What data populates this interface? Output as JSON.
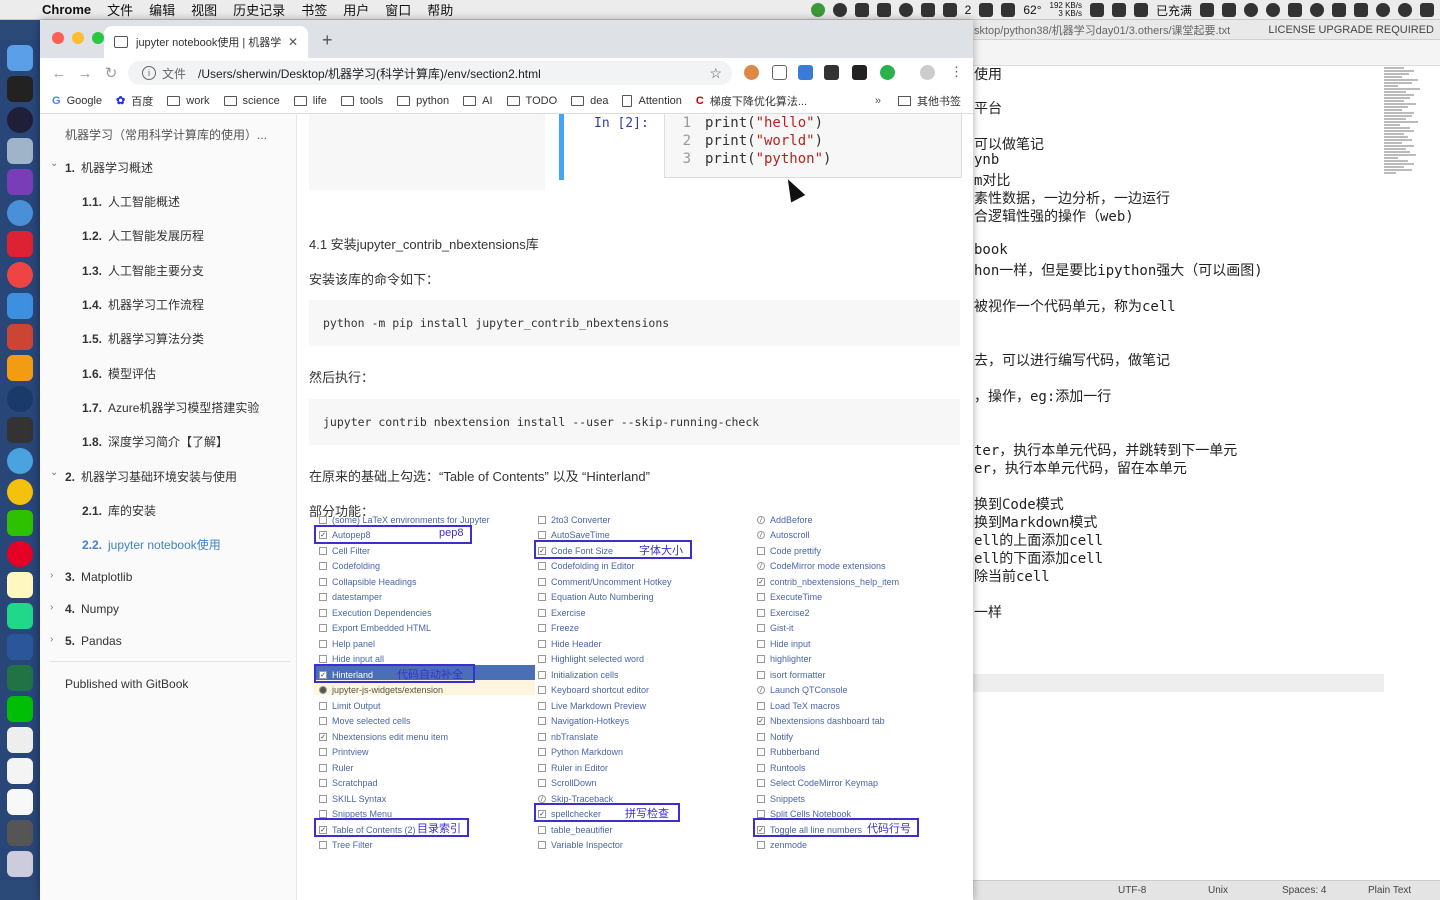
{
  "menubar": {
    "app": "Chrome",
    "items": [
      "文件",
      "编辑",
      "视图",
      "历史记录",
      "书签",
      "用户",
      "窗口",
      "帮助"
    ],
    "temperature": "62°",
    "net_up": "192 KB/s",
    "net_down": "3 KB/s",
    "battery": "已充满",
    "badge_count": "2"
  },
  "editor": {
    "title": "sktop/python38/机器学习day01/3.others/课堂起要.txt",
    "license": "LICENSE UPGRADE REQUIRED",
    "lines": [
      "使用",
      "平台",
      "可以做笔记",
      "ynb",
      "m对比",
      "素性数据，一边分析，一边运行",
      "合逻辑性强的操作（web)",
      "book",
      "hon一样，但是要比ipython强大（可以画图)",
      "被视作一个代码单元，称为cell",
      "去，可以进行编写代码，做笔记",
      "，操作，eg:添加一行",
      "ter，执行本单元代码，并跳转到下一单元",
      "er，执行本单元代码，留在本单元",
      "换到Code模式",
      "换到Markdown模式",
      "ell的上面添加cell",
      "ell的下面添加cell",
      "除当前cell",
      "一样"
    ],
    "status": {
      "encoding": "UTF-8",
      "line_endings": "Unix",
      "indent": "Spaces: 4",
      "syntax": "Plain Text"
    }
  },
  "browser": {
    "tab_title": "jupyter notebook使用 | 机器学",
    "url_scheme": "文件",
    "url": "/Users/sherwin/Desktop/机器学习(科学计算库)/env/section2.html",
    "bookmarks": [
      "Google",
      "百度",
      "work",
      "science",
      "life",
      "tools",
      "python",
      "AI",
      "TODO",
      "dea",
      "Attention",
      "梯度下降优化算法..."
    ],
    "bookmarks_more": "»",
    "other_bookmarks": "其他书签"
  },
  "sidebar": {
    "title": "机器学习（常用科学计算库的使用）...",
    "items": [
      {
        "num": "1.",
        "label": "机器学习概述"
      },
      {
        "num": "1.1.",
        "label": "人工智能概述"
      },
      {
        "num": "1.2.",
        "label": "人工智能发展历程"
      },
      {
        "num": "1.3.",
        "label": "人工智能主要分支"
      },
      {
        "num": "1.4.",
        "label": "机器学习工作流程"
      },
      {
        "num": "1.5.",
        "label": "机器学习算法分类"
      },
      {
        "num": "1.6.",
        "label": "模型评估"
      },
      {
        "num": "1.7.",
        "label": "Azure机器学习模型搭建实验"
      },
      {
        "num": "1.8.",
        "label": "深度学习简介【了解】"
      },
      {
        "num": "2.",
        "label": "机器学习基础环境安装与使用"
      },
      {
        "num": "2.1.",
        "label": "库的安装"
      },
      {
        "num": "2.2.",
        "label": "jupyter notebook使用"
      },
      {
        "num": "3.",
        "label": "Matplotlib"
      },
      {
        "num": "4.",
        "label": "Numpy"
      },
      {
        "num": "5.",
        "label": "Pandas"
      }
    ],
    "footer": "Published with GitBook"
  },
  "content": {
    "cell_prompt": "In [2]:",
    "cell_lines": [
      {
        "n": "1",
        "fn": "print(",
        "str": "\"hello\"",
        "end": ")"
      },
      {
        "n": "2",
        "fn": "print(",
        "str": "\"world\"",
        "end": ")"
      },
      {
        "n": "3",
        "fn": "print(",
        "str": "\"python\"",
        "end": ")"
      }
    ],
    "section_heading": "4.1 安装jupyter_contrib_nbextensions库",
    "install_intro": "安装该库的命令如下：",
    "install_cmd": "python -m pip install jupyter_contrib_nbextensions",
    "then_run": "然后执行：",
    "run_cmd": "jupyter contrib nbextension install --user --skip-running-check",
    "check_text": "在原来的基础上勾选：“Table of Contents” 以及 “Hinterland”",
    "features": "部分功能："
  },
  "extensions": {
    "col1": [
      {
        "label": "(some) LaTeX environments for Jupyter",
        "state": "none"
      },
      {
        "label": "Autopep8",
        "state": "on"
      },
      {
        "label": "Cell Filter",
        "state": "none"
      },
      {
        "label": "Codefolding",
        "state": "none"
      },
      {
        "label": "Collapsible Headings",
        "state": "none"
      },
      {
        "label": "datestamper",
        "state": "none"
      },
      {
        "label": "Execution Dependencies",
        "state": "none"
      },
      {
        "label": "Export Embedded HTML",
        "state": "none"
      },
      {
        "label": "Help panel",
        "state": "none"
      },
      {
        "label": "Hide input all",
        "state": "none"
      },
      {
        "label": "Hinterland",
        "state": "on"
      },
      {
        "label": "jupyter-js-widgets/extension",
        "state": "warn"
      },
      {
        "label": "Limit Output",
        "state": "none"
      },
      {
        "label": "Move selected cells",
        "state": "none"
      },
      {
        "label": "Nbextensions edit menu item",
        "state": "on"
      },
      {
        "label": "Printview",
        "state": "none"
      },
      {
        "label": "Ruler",
        "state": "none"
      },
      {
        "label": "Scratchpad",
        "state": "none"
      },
      {
        "label": "SKILL Syntax",
        "state": "none"
      },
      {
        "label": "Snippets Menu",
        "state": "none"
      },
      {
        "label": "Table of Contents (2)",
        "state": "on"
      },
      {
        "label": "Tree Filter",
        "state": "none"
      }
    ],
    "col2": [
      {
        "label": "2to3 Converter",
        "state": "none"
      },
      {
        "label": "AutoSaveTime",
        "state": "none"
      },
      {
        "label": "Code Font Size",
        "state": "on"
      },
      {
        "label": "Codefolding in Editor",
        "state": "none"
      },
      {
        "label": "Comment/Uncomment Hotkey",
        "state": "none"
      },
      {
        "label": "Equation Auto Numbering",
        "state": "none"
      },
      {
        "label": "Exercise",
        "state": "none"
      },
      {
        "label": "Freeze",
        "state": "none"
      },
      {
        "label": "Hide Header",
        "state": "none"
      },
      {
        "label": "Highlight selected word",
        "state": "none"
      },
      {
        "label": "Initialization cells",
        "state": "none"
      },
      {
        "label": "Keyboard shortcut editor",
        "state": "none"
      },
      {
        "label": "Live Markdown Preview",
        "state": "none"
      },
      {
        "label": "Navigation-Hotkeys",
        "state": "none"
      },
      {
        "label": "nbTranslate",
        "state": "none"
      },
      {
        "label": "Python Markdown",
        "state": "none"
      },
      {
        "label": "Ruler in Editor",
        "state": "none"
      },
      {
        "label": "ScrollDown",
        "state": "none"
      },
      {
        "label": "Skip-Traceback",
        "state": "off"
      },
      {
        "label": "spellchecker",
        "state": "on"
      },
      {
        "label": "table_beautifier",
        "state": "none"
      },
      {
        "label": "Variable Inspector",
        "state": "none"
      }
    ],
    "col3": [
      {
        "label": "AddBefore",
        "state": "off"
      },
      {
        "label": "Autoscroll",
        "state": "off"
      },
      {
        "label": "Code prettify",
        "state": "none"
      },
      {
        "label": "CodeMirror mode extensions",
        "state": "off"
      },
      {
        "label": "contrib_nbextensions_help_item",
        "state": "on"
      },
      {
        "label": "ExecuteTime",
        "state": "none"
      },
      {
        "label": "Exercise2",
        "state": "none"
      },
      {
        "label": "Gist-it",
        "state": "none"
      },
      {
        "label": "Hide input",
        "state": "none"
      },
      {
        "label": "highlighter",
        "state": "none"
      },
      {
        "label": "isort formatter",
        "state": "none"
      },
      {
        "label": "Launch QTConsole",
        "state": "off"
      },
      {
        "label": "Load TeX macros",
        "state": "none"
      },
      {
        "label": "Nbextensions dashboard tab",
        "state": "on"
      },
      {
        "label": "Notify",
        "state": "none"
      },
      {
        "label": "Rubberband",
        "state": "none"
      },
      {
        "label": "Runtools",
        "state": "none"
      },
      {
        "label": "Select CodeMirror Keymap",
        "state": "none"
      },
      {
        "label": "Snippets",
        "state": "none"
      },
      {
        "label": "Split Cells Notebook",
        "state": "none"
      },
      {
        "label": "Toggle all line numbers",
        "state": "on"
      },
      {
        "label": "zenmode",
        "state": "none"
      }
    ],
    "annotations": {
      "pep8": "pep8",
      "font_size": "字体大小",
      "hinterland": "代码自动补全",
      "toc": "目录索引",
      "spell": "拼写检查",
      "line_numbers": "代码行号"
    }
  }
}
